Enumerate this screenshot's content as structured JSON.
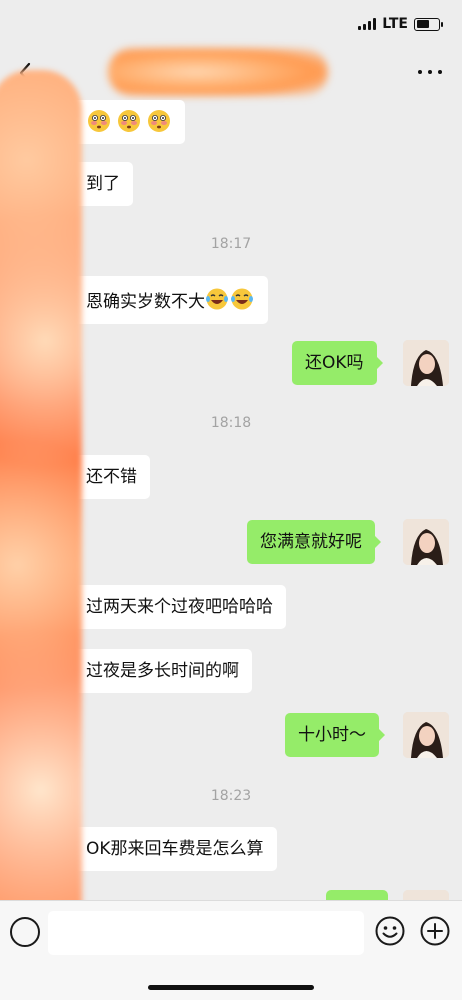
{
  "status_bar": {
    "network": "LTE"
  },
  "nav": {
    "title": ""
  },
  "messages": [
    {
      "side": "left",
      "text": "",
      "emoji": [
        "flushed-emoji",
        "flushed-emoji",
        "flushed-emoji"
      ]
    },
    {
      "side": "left",
      "text": "到了"
    },
    {
      "type": "time",
      "text": "18:17"
    },
    {
      "side": "left",
      "text": "恩确实岁数不大",
      "emoji": [
        "laughing-tears-emoji",
        "laughing-tears-emoji"
      ]
    },
    {
      "side": "right",
      "text": "还OK吗"
    },
    {
      "type": "time",
      "text": "18:18"
    },
    {
      "side": "left",
      "text": "还不错"
    },
    {
      "side": "right",
      "text": "您满意就好呢"
    },
    {
      "side": "left",
      "text": "过两天来个过夜吧哈哈哈"
    },
    {
      "side": "left",
      "text": "过夜是多长时间的啊"
    },
    {
      "side": "right",
      "text": "十小时～"
    },
    {
      "type": "time",
      "text": "18:23"
    },
    {
      "side": "left",
      "text": "OK那来回车费是怎么算"
    }
  ],
  "input": {
    "value": "",
    "placeholder": ""
  },
  "colors": {
    "background": "#ededed",
    "bubble_right": "#95ec69",
    "bubble_left": "#ffffff",
    "time_text": "#a3a3a3"
  }
}
